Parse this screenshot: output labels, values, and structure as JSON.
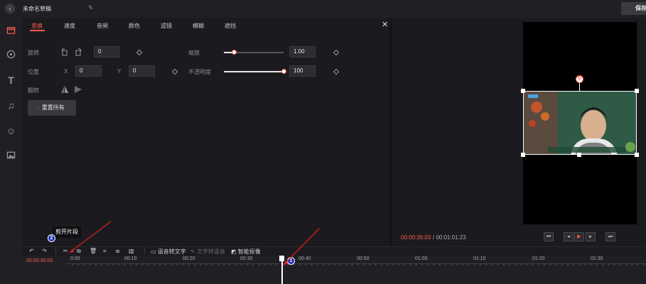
{
  "titlebar": {
    "title": "未命名草稿",
    "save_label": "保存",
    "back_icon": "back-arrow-icon",
    "edit_icon": "pencil-icon"
  },
  "rail": {
    "icons": [
      "video-clip-icon",
      "palette-icon",
      "text-icon",
      "music-icon",
      "emoji-icon",
      "image-icon"
    ]
  },
  "tabs": [
    {
      "label": "变换",
      "active": true
    },
    {
      "label": "速度"
    },
    {
      "label": "音频"
    },
    {
      "label": "颜色"
    },
    {
      "label": "滤镜"
    },
    {
      "label": "模糊"
    },
    {
      "label": "遮挡"
    }
  ],
  "props": {
    "rotate_label": "旋转",
    "rotate_value": "0",
    "scale_label": "缩放",
    "scale_value": "1.00",
    "scale_level": 0.17,
    "position_label": "位置",
    "x_label": "X",
    "x_value": "0",
    "y_label": "Y",
    "y_value": "0",
    "opacity_label": "不透明度",
    "opacity_value": "100",
    "opacity_level": 1.0,
    "flip_label": "翻转",
    "reset_label": "重置所有"
  },
  "preview": {
    "current_time": "00:00:36:03",
    "total_time": "/ 00:01:01:23",
    "rotate_handle_glyph": "G"
  },
  "toolbar": {
    "voice_to_text": "语音转文字",
    "text_to_voice": "文字转语音",
    "smart_cutout": "智能抠像",
    "tooltip": "剪开片段"
  },
  "timeline": {
    "current_tc": "00:00:36:03",
    "ticks": [
      "0:00",
      "00:10",
      "00:20",
      "00:30",
      "00:40",
      "00:50",
      "01:00",
      "01:10",
      "01:20",
      "01:30"
    ]
  },
  "annotations": {
    "badge_1": "1",
    "badge_2": "2"
  },
  "colors": {
    "accent": "#ff5a4e",
    "badge": "#1f2fb8"
  }
}
